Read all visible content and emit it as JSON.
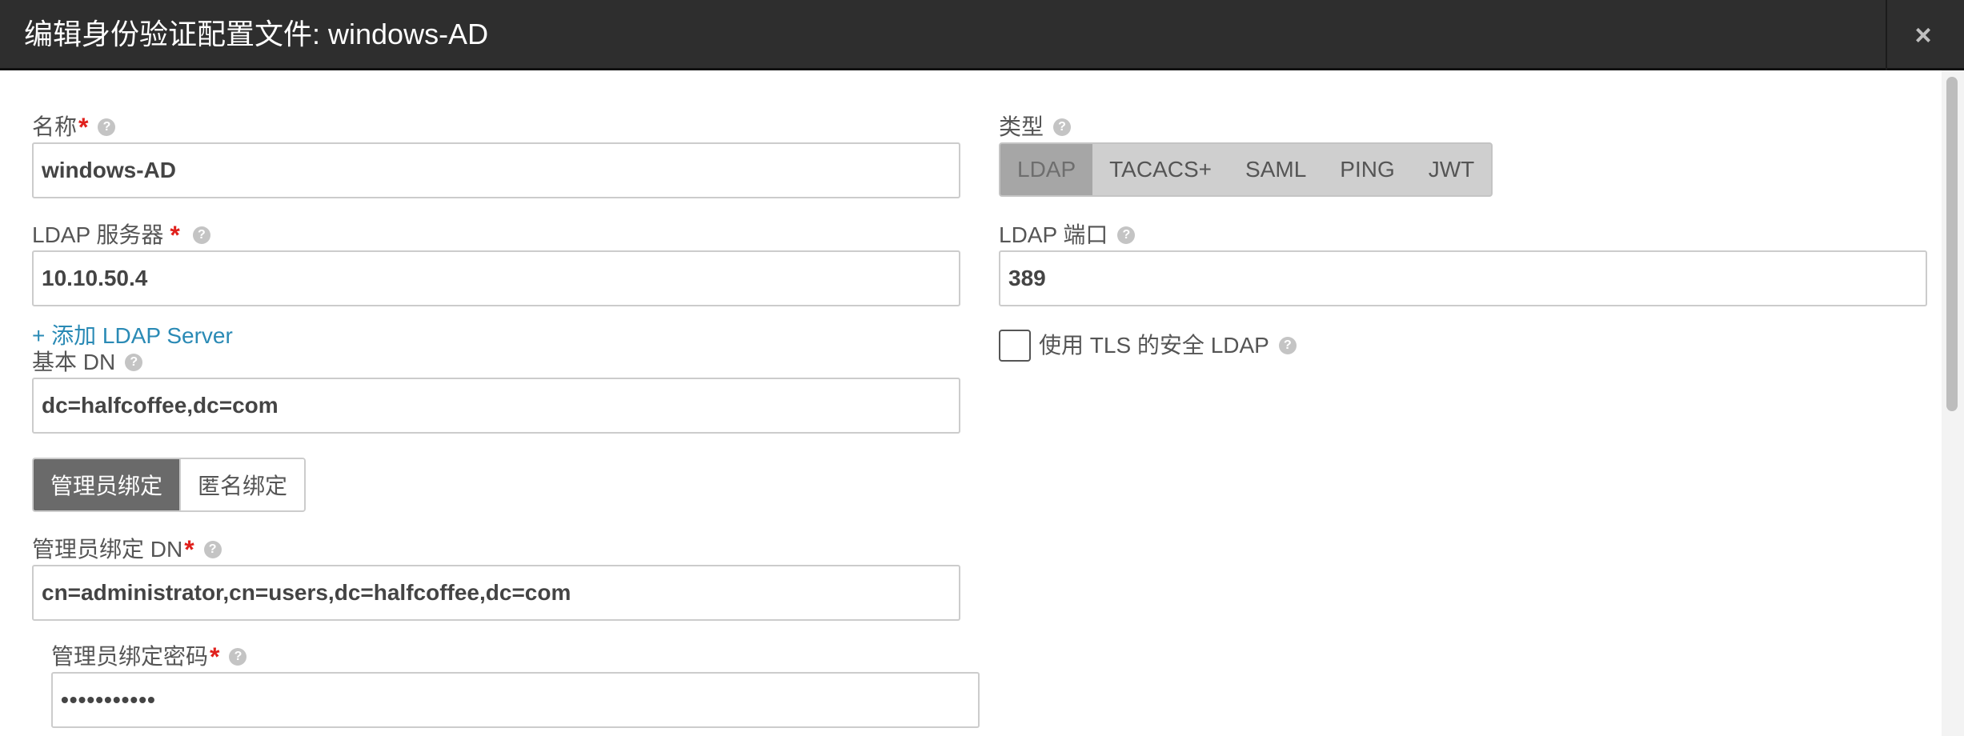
{
  "header": {
    "title": "编辑身份验证配置文件: windows-AD",
    "close_label": "×"
  },
  "form": {
    "name": {
      "label": "名称",
      "value": "windows-AD"
    },
    "type": {
      "label": "类型",
      "options": [
        "LDAP",
        "TACACS+",
        "SAML",
        "PING",
        "JWT"
      ],
      "selected": "LDAP"
    },
    "ldap_server": {
      "label": "LDAP 服务器",
      "value": "10.10.50.4"
    },
    "ldap_port": {
      "label": "LDAP 端口",
      "value": "389"
    },
    "add_server_link": "+ 添加 LDAP Server",
    "tls": {
      "label": "使用 TLS 的安全 LDAP",
      "checked": false
    },
    "base_dn": {
      "label": "基本 DN",
      "value": "dc=halfcoffee,dc=com"
    },
    "bind": {
      "options": [
        "管理员绑定",
        "匿名绑定"
      ],
      "selected": "管理员绑定"
    },
    "admin_bind_dn": {
      "label": "管理员绑定 DN",
      "value": "cn=administrator,cn=users,dc=halfcoffee,dc=com"
    },
    "admin_bind_password": {
      "label": "管理员绑定密码",
      "value": "•••••••••••"
    }
  },
  "required_marker": "*",
  "help_glyph": "?",
  "colors": {
    "header_bg": "#2e2e2e",
    "required": "#e0201c",
    "link": "#2a8ab5",
    "bind_active": "#6a6a6a"
  }
}
